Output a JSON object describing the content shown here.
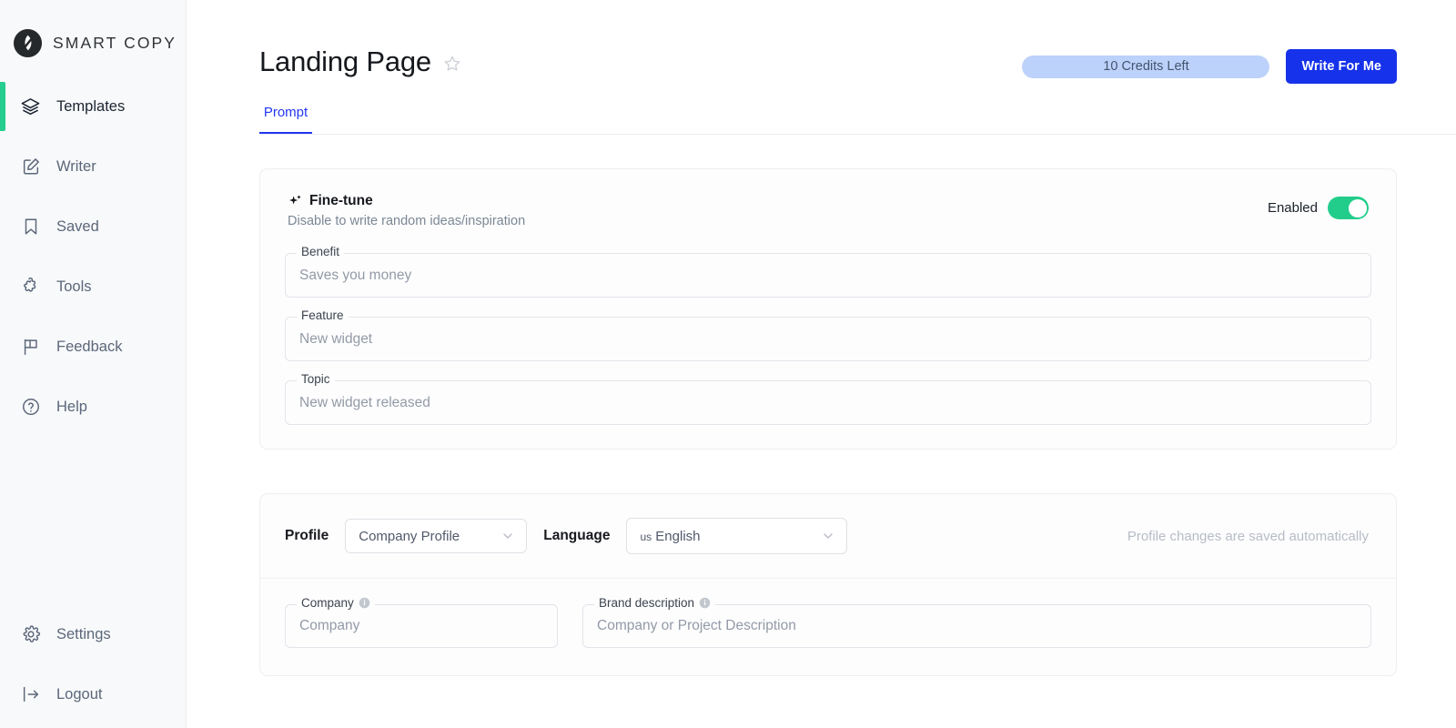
{
  "brand": {
    "name": "SMART COPY",
    "logo_icon": "smart-copy-logo"
  },
  "sidebar": {
    "items": [
      {
        "label": "Templates",
        "icon": "layers-icon",
        "active": true
      },
      {
        "label": "Writer",
        "icon": "pencil-square-icon",
        "active": false
      },
      {
        "label": "Saved",
        "icon": "bookmark-icon",
        "active": false
      },
      {
        "label": "Tools",
        "icon": "puzzle-icon",
        "active": false
      },
      {
        "label": "Feedback",
        "icon": "flag-icon",
        "active": false
      },
      {
        "label": "Help",
        "icon": "question-circle-icon",
        "active": false
      }
    ],
    "bottom_items": [
      {
        "label": "Settings",
        "icon": "gear-icon"
      },
      {
        "label": "Logout",
        "icon": "logout-icon"
      }
    ],
    "active_indicator_color": "#25cd8e"
  },
  "header": {
    "title": "Landing Page",
    "favorite_icon": "star-outline-icon",
    "credits_label": "10 Credits Left",
    "credits_pill_color": "#bdd2fb",
    "write_button_label": "Write For Me",
    "write_button_color": "#1632ea"
  },
  "tabs": [
    {
      "label": "Prompt",
      "active": true
    }
  ],
  "finetune": {
    "icon": "sparkle-icon",
    "title": "Fine-tune",
    "subtitle": "Disable to write random ideas/inspiration",
    "toggle_label": "Enabled",
    "toggle_on": true,
    "toggle_color": "#22cd8b",
    "fields": [
      {
        "label": "Benefit",
        "placeholder": "Saves you money",
        "value": ""
      },
      {
        "label": "Feature",
        "placeholder": "New widget",
        "value": ""
      },
      {
        "label": "Topic",
        "placeholder": "New widget released",
        "value": ""
      }
    ]
  },
  "profile": {
    "profile_label": "Profile",
    "profile_value": "Company Profile",
    "language_label": "Language",
    "language_flag": "us",
    "language_value": "English",
    "note": "Profile changes are saved automatically",
    "fields": [
      {
        "label": "Company",
        "placeholder": "Company",
        "value": "",
        "info_icon": "info-circle-icon"
      },
      {
        "label": "Brand description",
        "placeholder": "Company or Project Description",
        "value": "",
        "info_icon": "info-circle-icon"
      }
    ]
  }
}
